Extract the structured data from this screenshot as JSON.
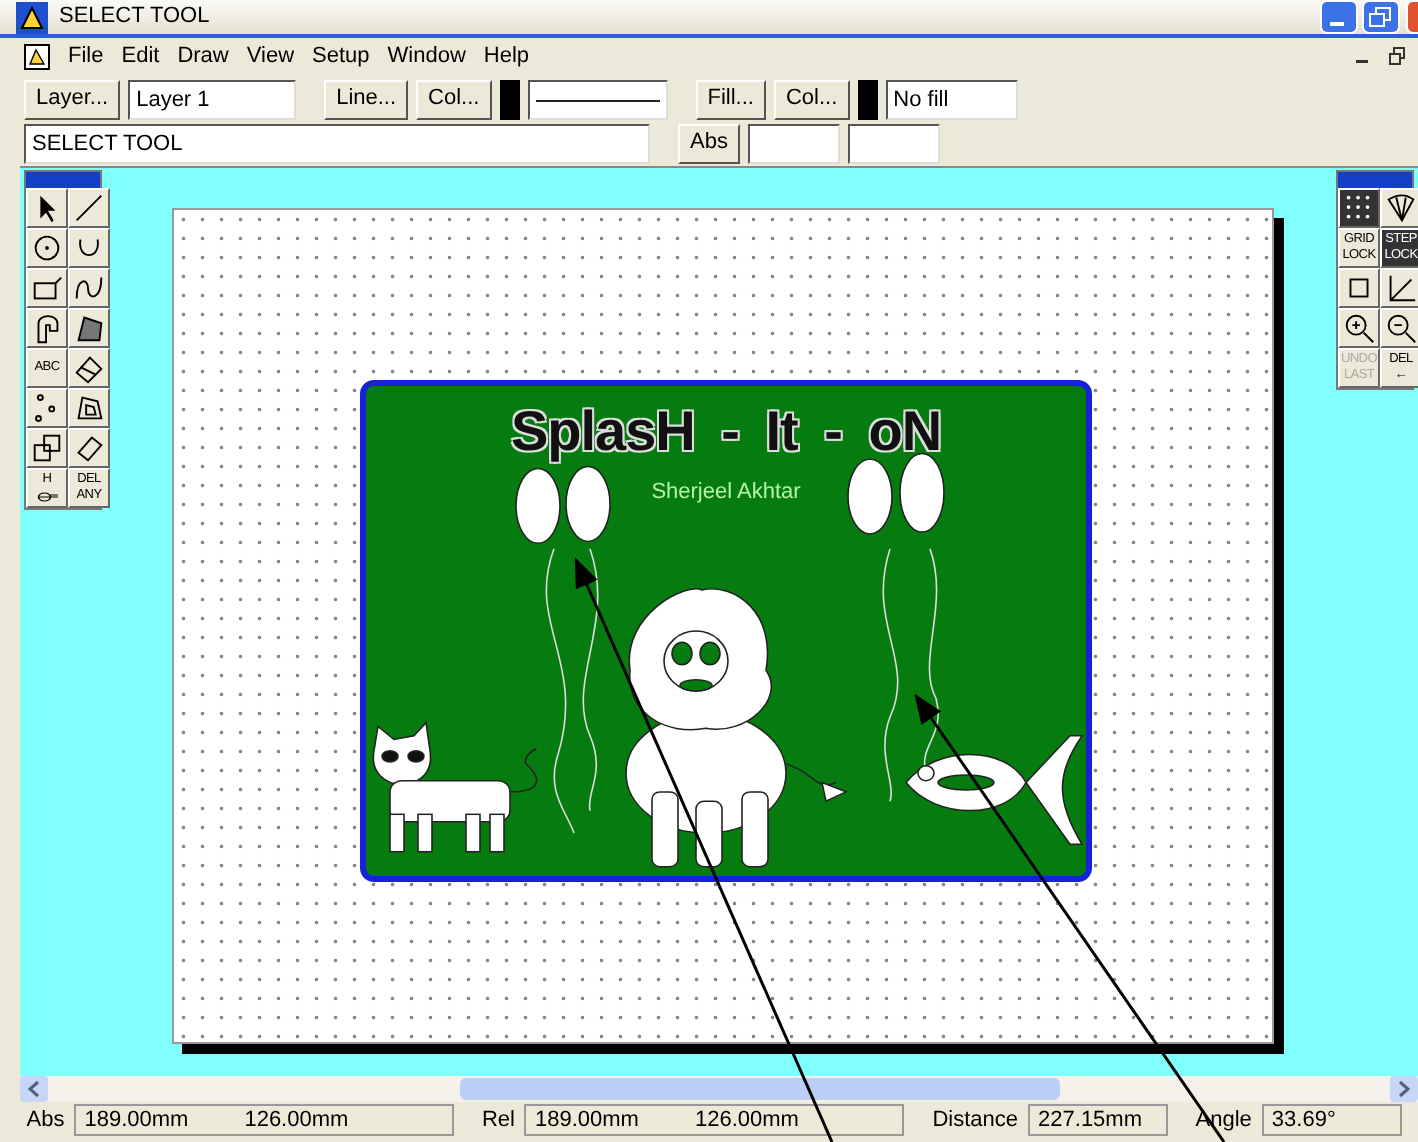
{
  "window": {
    "title": "SELECT TOOL"
  },
  "menu": [
    "File",
    "Edit",
    "Draw",
    "View",
    "Setup",
    "Window",
    "Help"
  ],
  "toolbar": {
    "layer_button": "Layer...",
    "layer_field": "Layer 1",
    "line_button": "Line...",
    "line_color_button": "Col...",
    "fill_button": "Fill...",
    "fill_color_button": "Col...",
    "fill_field": "No fill",
    "tool_field": "SELECT TOOL",
    "abs_button": "Abs"
  },
  "left_tools": [
    {
      "kind": "pointer",
      "selected": false
    },
    {
      "kind": "line",
      "selected": false
    },
    {
      "kind": "circle",
      "selected": false
    },
    {
      "kind": "arc",
      "selected": false
    },
    {
      "kind": "rect",
      "selected": false
    },
    {
      "kind": "curve",
      "selected": false
    },
    {
      "kind": "pipe",
      "selected": false
    },
    {
      "kind": "hatch",
      "selected": false
    },
    {
      "kind": "text",
      "label": [
        "ABC"
      ],
      "selected": false
    },
    {
      "kind": "dimension",
      "selected": false
    },
    {
      "kind": "points",
      "selected": false
    },
    {
      "kind": "polygon",
      "selected": false
    },
    {
      "kind": "copy",
      "selected": false
    },
    {
      "kind": "block",
      "selected": false
    },
    {
      "kind": "labeled",
      "label": [
        "H"
      ],
      "selected": false
    },
    {
      "kind": "text",
      "label": [
        "DEL",
        "ANY"
      ],
      "selected": false
    }
  ],
  "right_tools": [
    {
      "kind": "grid",
      "selected": true,
      "disabled": false
    },
    {
      "kind": "fan",
      "selected": false,
      "disabled": false
    },
    {
      "kind": "text",
      "label": [
        "GRID",
        "LOCK"
      ],
      "selected": false,
      "disabled": false
    },
    {
      "kind": "text",
      "label": [
        "STEP",
        "LOCK"
      ],
      "selected": true,
      "disabled": false
    },
    {
      "kind": "square",
      "selected": false,
      "disabled": false
    },
    {
      "kind": "axes",
      "selected": false,
      "disabled": false
    },
    {
      "kind": "zoom-in",
      "selected": false,
      "disabled": false
    },
    {
      "kind": "zoom-out",
      "selected": false,
      "disabled": false
    },
    {
      "kind": "text",
      "label": [
        "UNDO",
        "LAST"
      ],
      "selected": false,
      "disabled": true
    },
    {
      "kind": "text",
      "label": [
        "DEL",
        "←"
      ],
      "selected": false,
      "disabled": false
    }
  ],
  "canvas": {
    "title": "SplasH - It - oN",
    "author": "Sherjeel Akhtar"
  },
  "status_bar": [
    {
      "label": "Abs",
      "values": [
        "189.00mm",
        "126.00mm"
      ]
    },
    {
      "label": "Rel",
      "values": [
        "189.00mm",
        "126.00mm"
      ]
    },
    {
      "label": "Distance",
      "values": [
        "227.15mm"
      ]
    },
    {
      "label": "Angle",
      "values": [
        "33.69°"
      ]
    }
  ]
}
